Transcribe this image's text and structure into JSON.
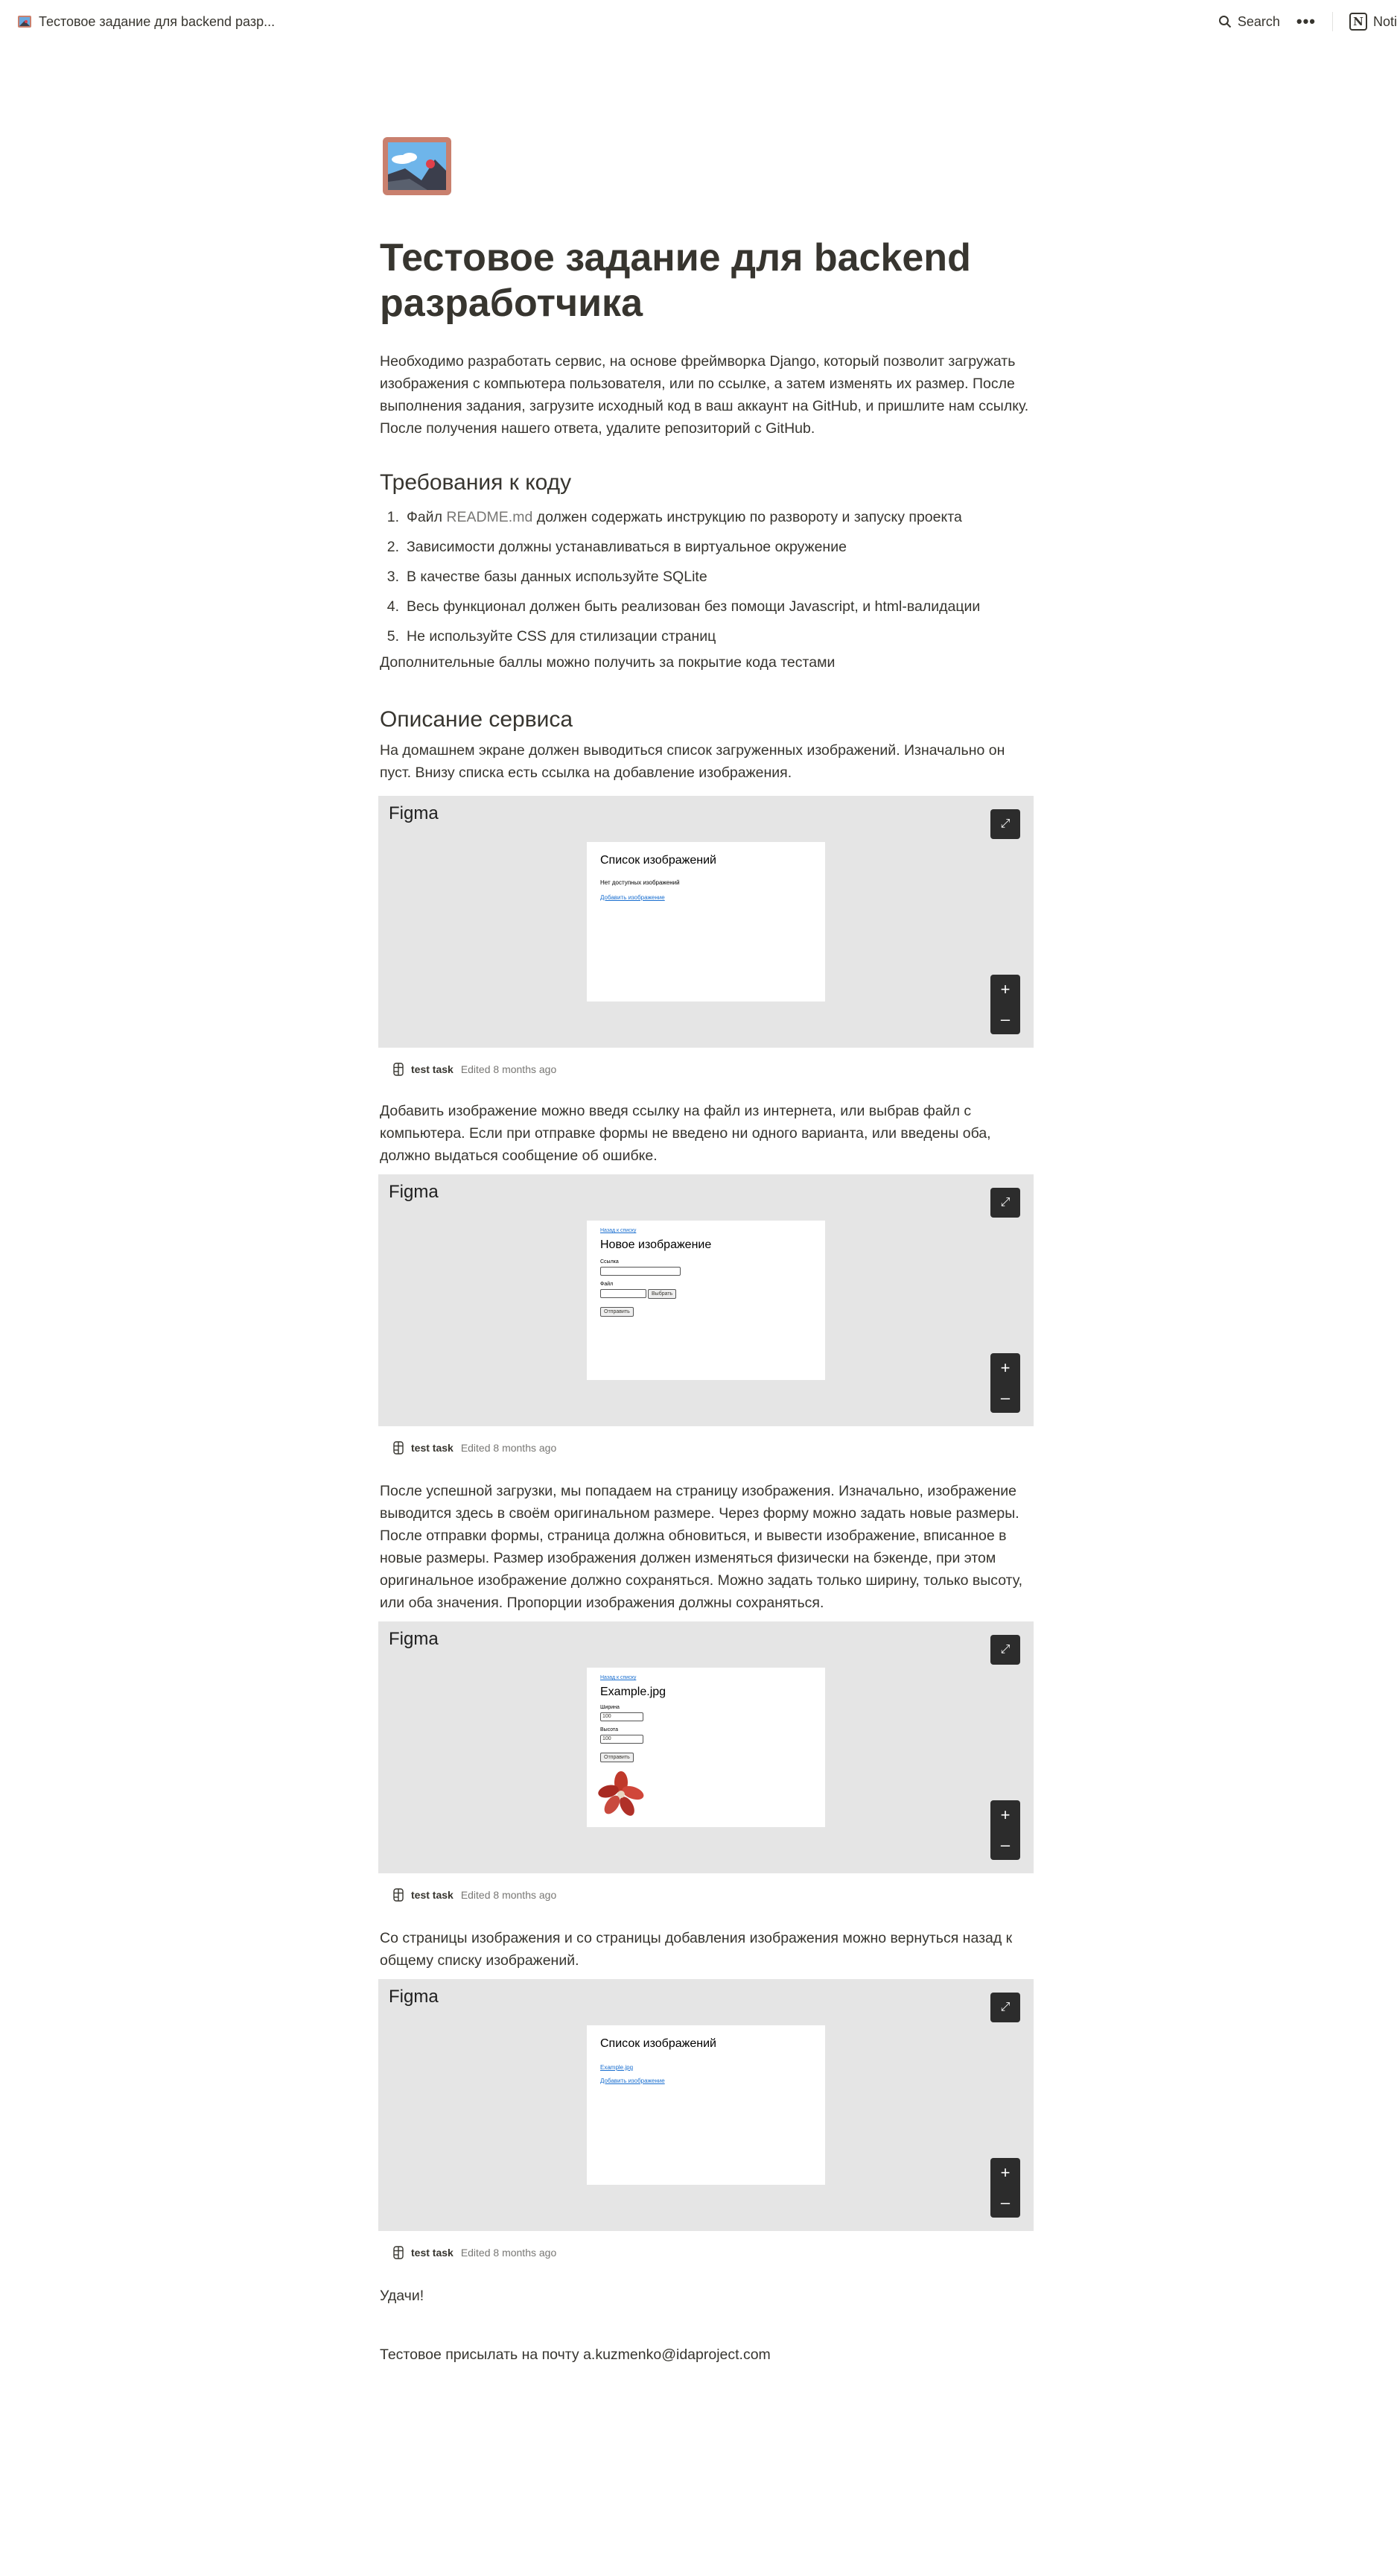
{
  "topbar": {
    "breadcrumb": "Тестовое задание для backend разр...",
    "search_label": "Search",
    "more_label": "•••",
    "notion_label": "Noti"
  },
  "page": {
    "title": "Тестовое задание для backend разработчика",
    "intro": "Необходимо разработать сервис, на основе фреймворка Django, который позволит загружать изображения с компьютера пользователя, или по ссылке, а затем изменять их размер. После выполнения задания, загрузите исходный код в ваш аккаунт на GitHub, и пришлите нам ссылку.  После получения нашего ответа, удалите репозиторий с GitHub.",
    "req_heading": "Требования к коду",
    "requirements": [
      {
        "num": "1.",
        "pre": "Файл ",
        "code": "README.md",
        "post": " должен содержать инструкцию по развороту и запуску проекта"
      },
      {
        "num": "2.",
        "text": "Зависимости должны устанавливаться в виртуальное окружение"
      },
      {
        "num": "3.",
        "text": "В качестве базы данных используйте SQLite"
      },
      {
        "num": "4.",
        "text": "Весь функционал должен быть реализован без помощи Javascript, и html-валидации"
      },
      {
        "num": "5.",
        "text": "Не используйте CSS для стилизации страниц"
      }
    ],
    "extra": "Дополнительные баллы можно получить за покрытие кода тестами",
    "service_heading": "Описание сервиса",
    "p1": "На домашнем экране должен выводиться список загруженных изображений. Изначально он пуст. Внизу списка есть ссылка на добавление изображения.",
    "p2": "Добавить изображение можно введя ссылку на файл из интернета, или выбрав файл с компьютера. Если при отправке формы не введено ни одного варианта, или введены оба, должно выдаться сообщение об ошибке.",
    "p3": "После успешной загрузки, мы попадаем на страницу изображения. Изначально, изображение выводится здесь в своём оригинальном размере. Через форму можно задать новые размеры. После отправки формы, страница должна обновиться, и вывести изображение, вписанное в новые размеры. Размер изображения должен изменяться физически на бэкенде, при этом оригинальное изображение должно сохраняться. Можно задать только ширину, только высоту, или оба значения. Пропорции изображения должны  сохраняться.",
    "p4": "Со страницы изображения и со страницы добавления изображения можно вернуться назад к общему списку изображений.",
    "luck": "Удачи!",
    "contact": "Тестовое присылать на почту a.kuzmenko@idaproject.com"
  },
  "figma": {
    "label": "Figma",
    "expand_icon": "⤢",
    "zoom_in": "+",
    "zoom_out": "–",
    "caption_name": "test task",
    "caption_edited": "Edited 8 months ago"
  },
  "frames": {
    "list_empty": {
      "title": "Список изображений",
      "empty": "Нет доступных изображений",
      "add_link": "Добавить изображение"
    },
    "new_image": {
      "back": "Назад к списку",
      "title": "Новое изображение",
      "link_label": "Ссылка",
      "file_label": "Файл",
      "choose_btn": "Выбрать",
      "submit_btn": "Отправить"
    },
    "image_page": {
      "back": "Назад к списку",
      "title": "Example.jpg",
      "width_label": "Ширина",
      "width_value": "100",
      "height_label": "Высота",
      "height_value": "100",
      "submit_btn": "Отправить"
    },
    "list_full": {
      "title": "Список изображений",
      "item": "Example.jpg",
      "add_link": "Добавить изображение"
    }
  }
}
